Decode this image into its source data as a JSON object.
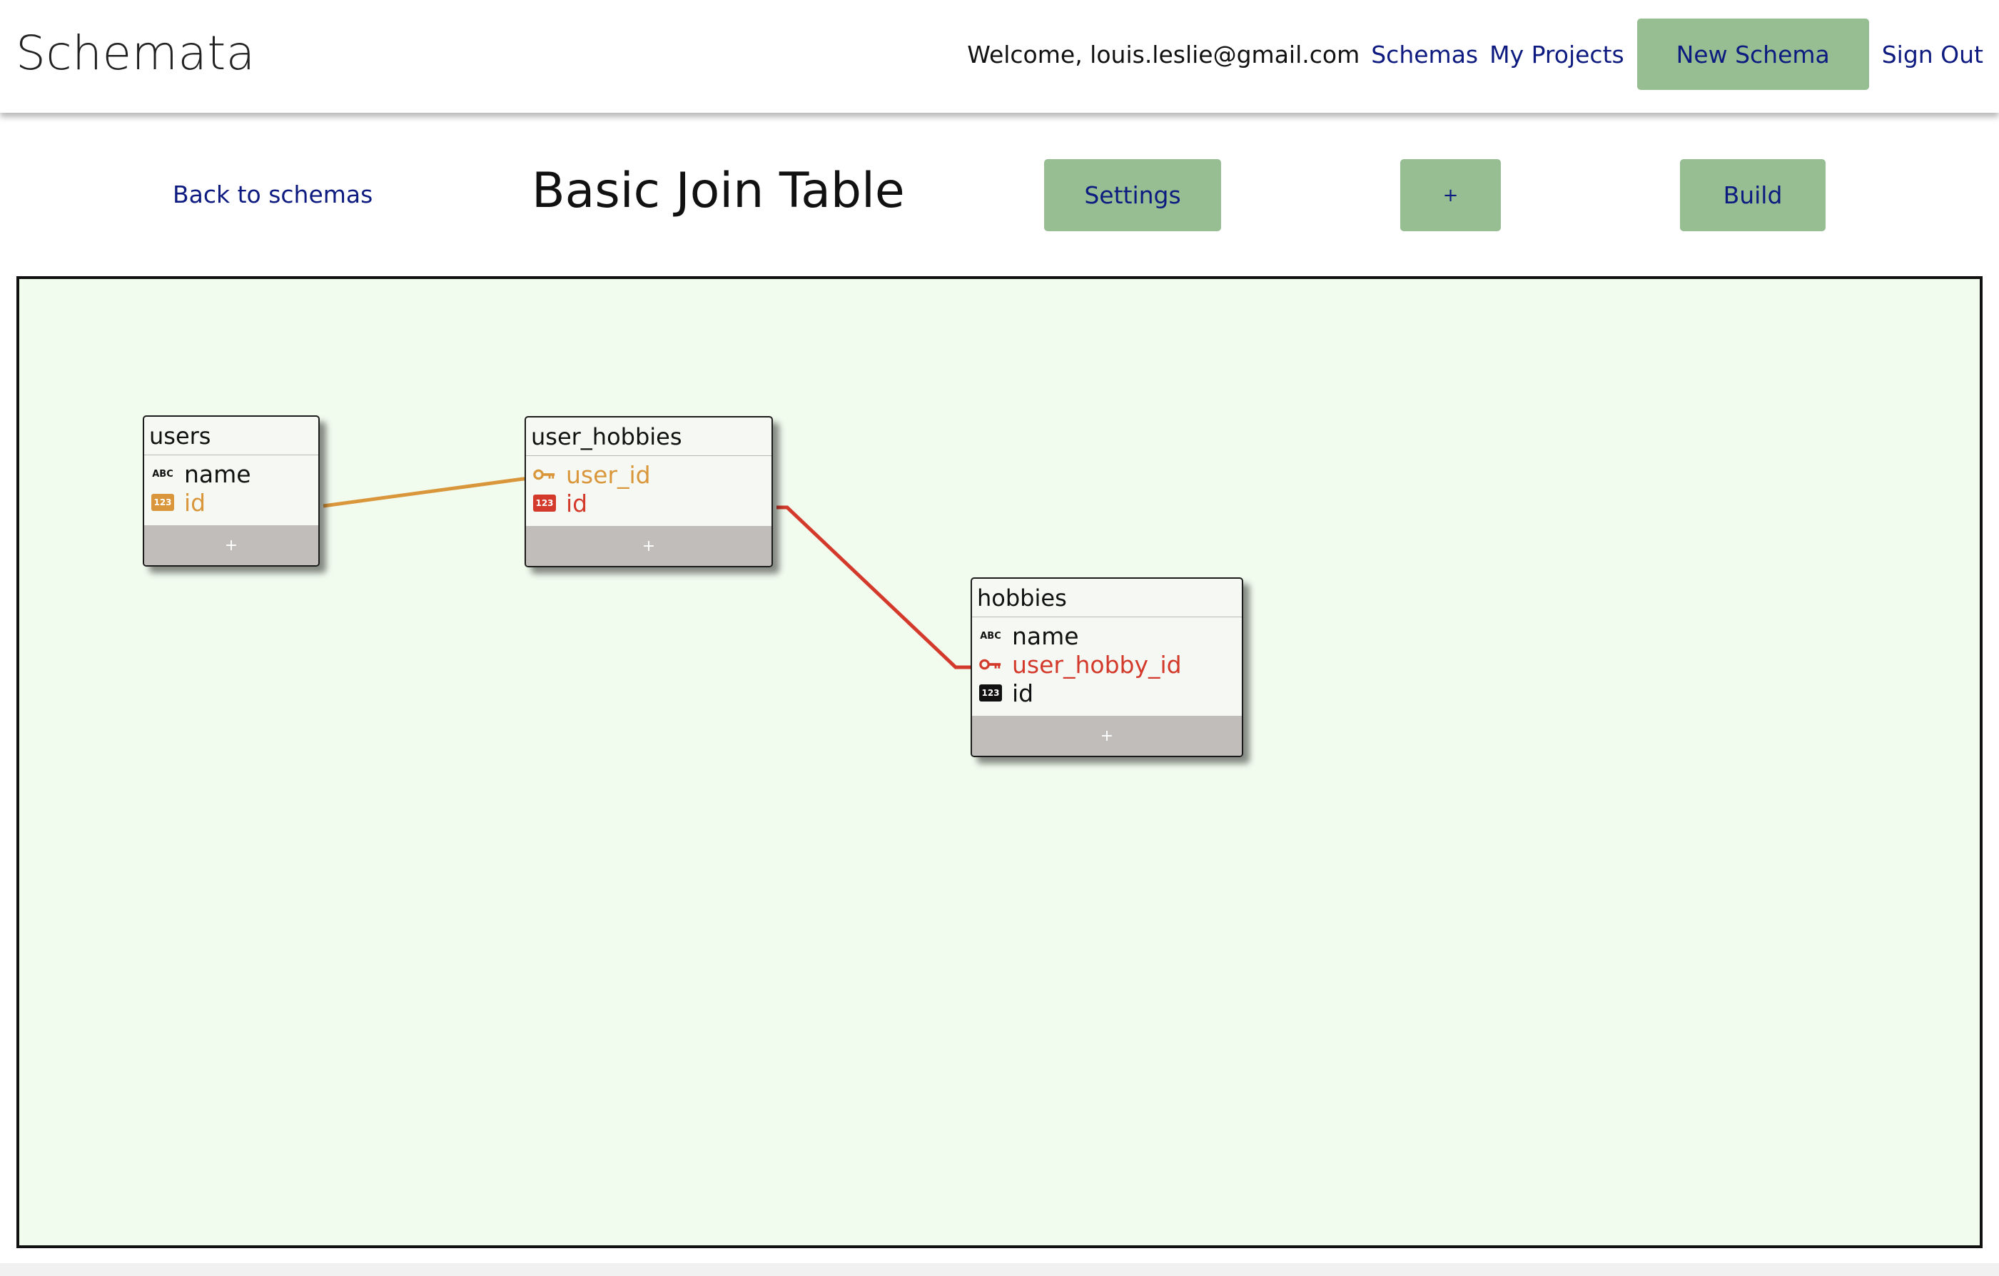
{
  "navbar": {
    "brand": "Schemata",
    "welcome": "Welcome, louis.leslie@gmail.com",
    "schemas_link": "Schemas",
    "projects_link": "My Projects",
    "new_schema_button": "New Schema",
    "sign_out_link": "Sign Out"
  },
  "subheader": {
    "back_link": "Back to schemas",
    "title": "Basic Join Table",
    "settings_button": "Settings",
    "add_button": "+",
    "build_button": "Build"
  },
  "colors": {
    "accent_button": "#97bd92",
    "link": "#0d1a80",
    "canvas_bg": "#f1fbee",
    "relation_orange": "#d9963a",
    "relation_red": "#d33a2b",
    "footer_gray": "#c1bdbb"
  },
  "tables": [
    {
      "name": "users",
      "add_label": "+",
      "fields": [
        {
          "name": "name",
          "type_icon": "abc-icon",
          "icon_text": "ABC",
          "color": "#111111"
        },
        {
          "name": "id",
          "type_icon": "number-icon",
          "icon_text": "123",
          "color": "#d9963a"
        }
      ]
    },
    {
      "name": "user_hobbies",
      "add_label": "+",
      "fields": [
        {
          "name": "user_id",
          "type_icon": "key-icon",
          "color": "#d9963a"
        },
        {
          "name": "id",
          "type_icon": "number-icon",
          "icon_text": "123",
          "color": "#d33a2b"
        }
      ]
    },
    {
      "name": "hobbies",
      "add_label": "+",
      "fields": [
        {
          "name": "name",
          "type_icon": "abc-icon",
          "icon_text": "ABC",
          "color": "#111111"
        },
        {
          "name": "user_hobby_id",
          "type_icon": "key-icon",
          "color": "#d33a2b"
        },
        {
          "name": "id",
          "type_icon": "number-icon",
          "icon_text": "123",
          "color": "#111111"
        }
      ]
    }
  ],
  "relations": [
    {
      "from": "users.id",
      "to": "user_hobbies.user_id",
      "color": "#d9963a"
    },
    {
      "from": "user_hobbies.id",
      "to": "hobbies.user_hobby_id",
      "color": "#d33a2b"
    }
  ]
}
